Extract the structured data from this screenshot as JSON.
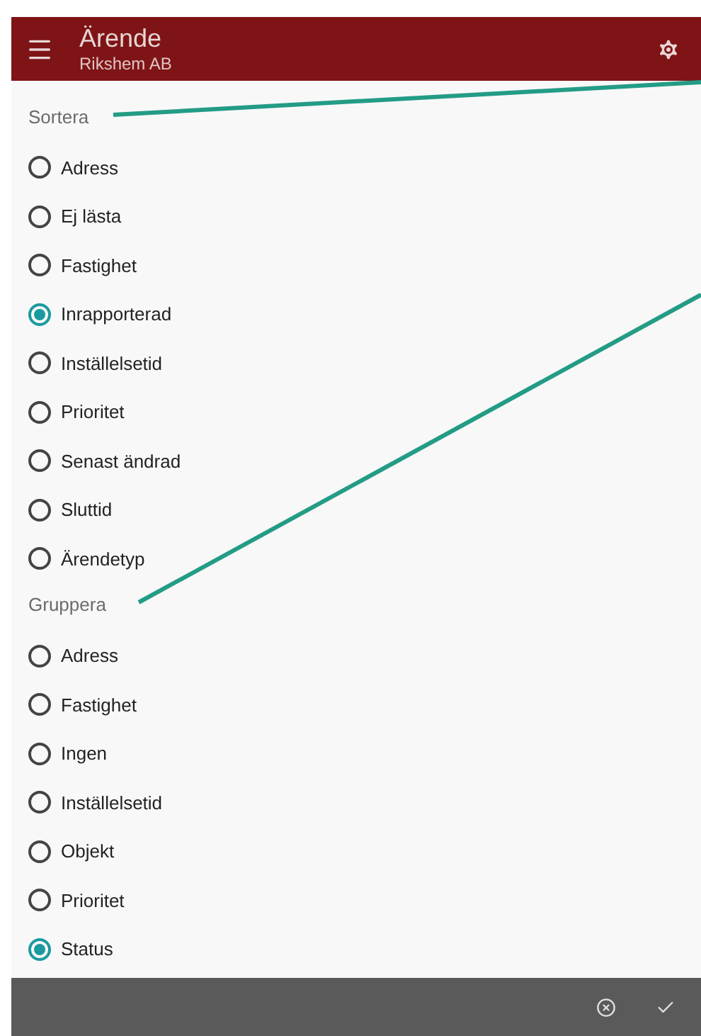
{
  "app_bar": {
    "title": "Ärende",
    "subtitle": "Rikshem AB"
  },
  "sections": [
    {
      "header": "Sortera",
      "options": [
        {
          "label": "Adress",
          "selected": false
        },
        {
          "label": "Ej lästa",
          "selected": false
        },
        {
          "label": "Fastighet",
          "selected": false
        },
        {
          "label": "Inrapporterad",
          "selected": true
        },
        {
          "label": "Inställelsetid",
          "selected": false
        },
        {
          "label": "Prioritet",
          "selected": false
        },
        {
          "label": "Senast ändrad",
          "selected": false
        },
        {
          "label": "Sluttid",
          "selected": false
        },
        {
          "label": "Ärendetyp",
          "selected": false
        }
      ]
    },
    {
      "header": "Gruppera",
      "options": [
        {
          "label": "Adress",
          "selected": false
        },
        {
          "label": "Fastighet",
          "selected": false
        },
        {
          "label": "Ingen",
          "selected": false
        },
        {
          "label": "Inställelsetid",
          "selected": false
        },
        {
          "label": "Objekt",
          "selected": false
        },
        {
          "label": "Prioritet",
          "selected": false
        },
        {
          "label": "Status",
          "selected": true
        }
      ]
    }
  ]
}
